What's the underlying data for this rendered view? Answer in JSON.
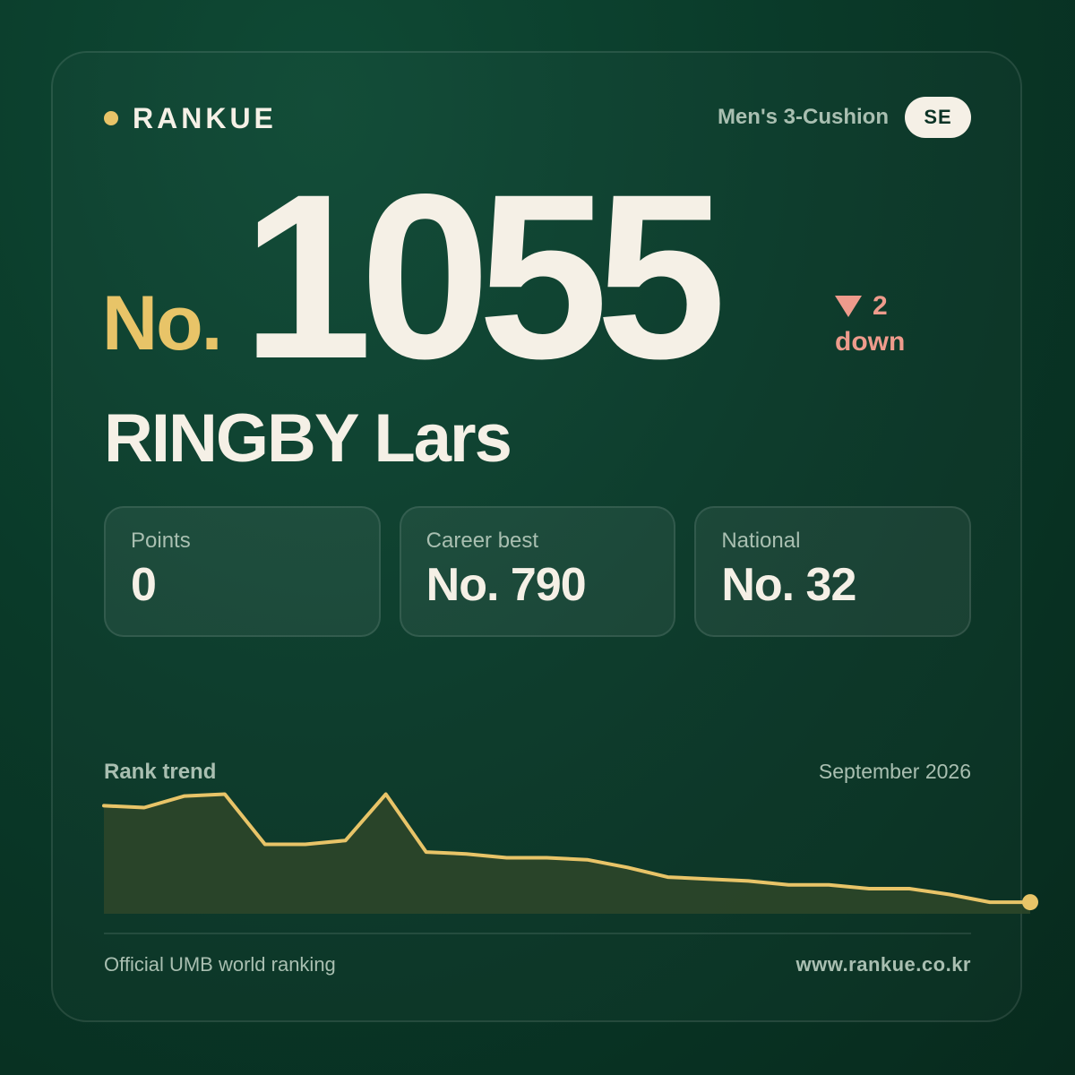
{
  "brand": {
    "name": "RANKUE",
    "dot_color": "#e8c468"
  },
  "header": {
    "category": "Men's 3-Cushion",
    "country_code": "SE"
  },
  "rank": {
    "prefix": "No.",
    "number": "1055",
    "change_value": "2",
    "change_label": "down",
    "change_direction": "down",
    "change_color": "#ee9b8c",
    "accent_color": "#e8c468"
  },
  "player": {
    "name": "RINGBY Lars"
  },
  "stats": [
    {
      "label": "Points",
      "value": "0"
    },
    {
      "label": "Career best",
      "value": "No. 790"
    },
    {
      "label": "National",
      "value": "No. 32"
    }
  ],
  "trend": {
    "label": "Rank trend",
    "date": "September 2026",
    "line_color": "#e8c468",
    "fill_color": "#2c4629"
  },
  "chart_data": {
    "type": "area",
    "y_inverted": true,
    "values": [
      1045,
      1046,
      1040,
      1039,
      1065,
      1065,
      1063,
      1039,
      1069,
      1070,
      1072,
      1072,
      1073,
      1077,
      1082,
      1083,
      1084,
      1086,
      1086,
      1088,
      1088,
      1091,
      1095,
      1095
    ],
    "ylim": [
      1036,
      1101
    ],
    "grid": false,
    "legend": false
  },
  "footer": {
    "source": "Official UMB world ranking",
    "url": "www.rankue.co.kr"
  }
}
